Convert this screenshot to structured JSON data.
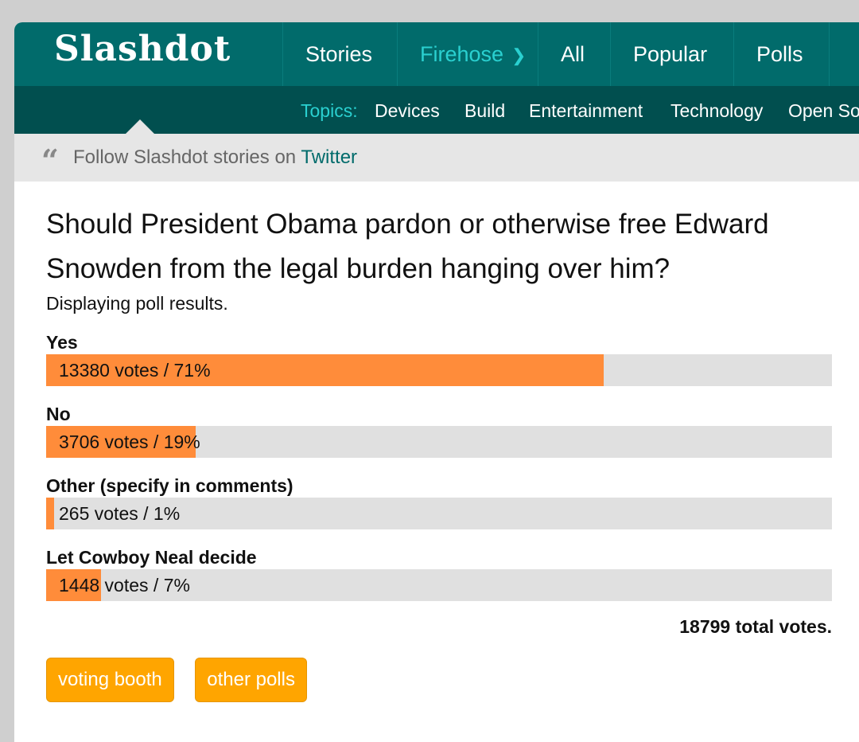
{
  "header": {
    "logo": "Slashdot",
    "nav": [
      {
        "label": "Stories"
      },
      {
        "label": "Firehose"
      },
      {
        "label": "All"
      },
      {
        "label": "Popular"
      },
      {
        "label": "Polls"
      }
    ],
    "topics_label": "Topics:",
    "topics": [
      "Devices",
      "Build",
      "Entertainment",
      "Technology",
      "Open So"
    ]
  },
  "follow": {
    "icon": "quote-icon",
    "text": "Follow Slashdot stories on ",
    "link": "Twitter"
  },
  "poll": {
    "question": "Should President Obama pardon or otherwise free Edward Snowden from the legal burden hanging over him?",
    "subtitle": "Displaying poll results.",
    "options": [
      {
        "label": "Yes",
        "result": "13380 votes / 71%",
        "percent": 71
      },
      {
        "label": "No",
        "result": "3706 votes / 19%",
        "percent": 19
      },
      {
        "label": "Other (specify in comments)",
        "result": "265 votes / 1%",
        "percent": 1
      },
      {
        "label": "Let Cowboy Neal decide",
        "result": "1448 votes / 7%",
        "percent": 7
      }
    ],
    "total": "18799 total votes.",
    "buttons": [
      "voting booth",
      "other polls"
    ]
  },
  "colors": {
    "nav_bg": "#016b6b",
    "subnav_bg": "#014f4f",
    "accent_teal": "#2ad0d0",
    "bar_fill": "#ff8c3a",
    "bar_bg": "#e0e0e0",
    "button_bg": "#ffa500"
  }
}
